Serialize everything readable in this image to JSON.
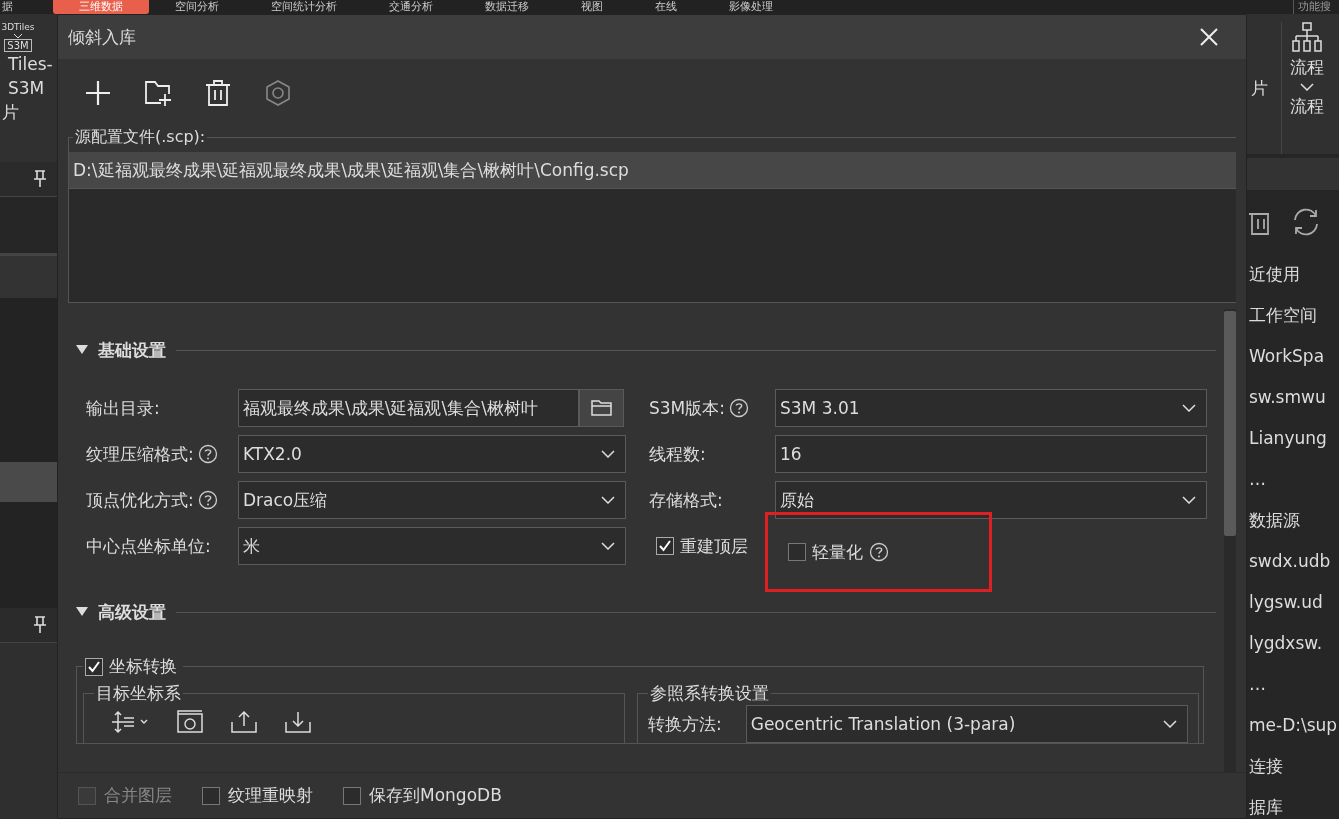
{
  "menu_tabs": [
    {
      "label": "据",
      "selected": false
    },
    {
      "label": "三维数据",
      "selected": true
    },
    {
      "label": "空间分析",
      "selected": false
    },
    {
      "label": "空间统计分析",
      "selected": false
    },
    {
      "label": "交通分析",
      "selected": false
    },
    {
      "label": "数据迁移",
      "selected": false
    },
    {
      "label": "视图",
      "selected": false
    },
    {
      "label": "在线",
      "selected": false
    },
    {
      "label": "影像处理",
      "selected": false
    }
  ],
  "left_panel": {
    "ribbon_icon_text": "3DTiles",
    "ribbon_badge": "S3M",
    "ribbon_lines": [
      "Tiles-",
      "S3M",
      "片"
    ]
  },
  "right_panel": {
    "search": "功能搜",
    "ribbon_side": "片",
    "ribbon_button": "流程",
    "ribbon_group": "流程",
    "items": [
      "近使用",
      "工作空间",
      "WorkSpa",
      "sw.smwu",
      "Lianyung",
      "…",
      "数据源",
      "swdx.udb",
      "lygsw.ud",
      "lygdxsw.",
      "…",
      "me-D:\\sup",
      "连接",
      "据库"
    ]
  },
  "dialog": {
    "title": "倾斜入库",
    "toolbar": [
      {
        "kind": "add",
        "disabled": false
      },
      {
        "kind": "add-folder",
        "disabled": false
      },
      {
        "kind": "delete",
        "disabled": false
      },
      {
        "kind": "settings",
        "disabled": true
      }
    ],
    "source_files": {
      "label": "源配置文件(.scp):",
      "items": [
        {
          "path": "D:\\延福观最终成果\\延福观最终成果\\成果\\延福观\\集合\\楸树叶\\Config.scp",
          "selected": true
        }
      ]
    },
    "basic": {
      "title": "基础设置",
      "expanded": true,
      "fields": [
        {
          "kind": "path",
          "label": "输出目录:",
          "help": false,
          "value": "福观最终成果\\成果\\延福观\\集合\\楸树叶"
        },
        {
          "kind": "select",
          "label": "S3M版本:",
          "help": true,
          "value": "S3M 3.01"
        },
        {
          "kind": "select",
          "label": "纹理压缩格式:",
          "help": true,
          "value": "KTX2.0"
        },
        {
          "kind": "text",
          "label": "线程数:",
          "help": false,
          "value": "16"
        },
        {
          "kind": "select",
          "label": "顶点优化方式:",
          "help": true,
          "value": "Draco压缩"
        },
        {
          "kind": "select",
          "label": "存储格式:",
          "help": false,
          "value": "原始"
        },
        {
          "kind": "select",
          "label": "中心点坐标单位:",
          "help": false,
          "value": "米"
        },
        {
          "kind": "checks",
          "items": [
            {
              "label": "重建顶层",
              "checked": true,
              "help": false,
              "highlighted": false
            },
            {
              "label": "轻量化",
              "checked": false,
              "help": true,
              "highlighted": true
            }
          ]
        }
      ]
    },
    "advanced": {
      "title": "高级设置",
      "expanded": true,
      "coord_transform": {
        "label": "坐标转换",
        "checked": true,
        "target": {
          "title": "目标坐标系",
          "tools": [
            {
              "kind": "swap",
              "dropdown": true
            },
            {
              "kind": "frame"
            },
            {
              "kind": "export"
            },
            {
              "kind": "import"
            }
          ]
        },
        "reference": {
          "title": "参照系转换设置",
          "method_label": "转换方法:",
          "method": "Geocentric Translation (3-para)"
        }
      }
    },
    "footer": [
      {
        "label": "合并图层",
        "checked": false,
        "disabled": true
      },
      {
        "label": "纹理重映射",
        "checked": false,
        "disabled": false
      },
      {
        "label": "保存到MongoDB",
        "checked": false,
        "disabled": false
      }
    ]
  }
}
